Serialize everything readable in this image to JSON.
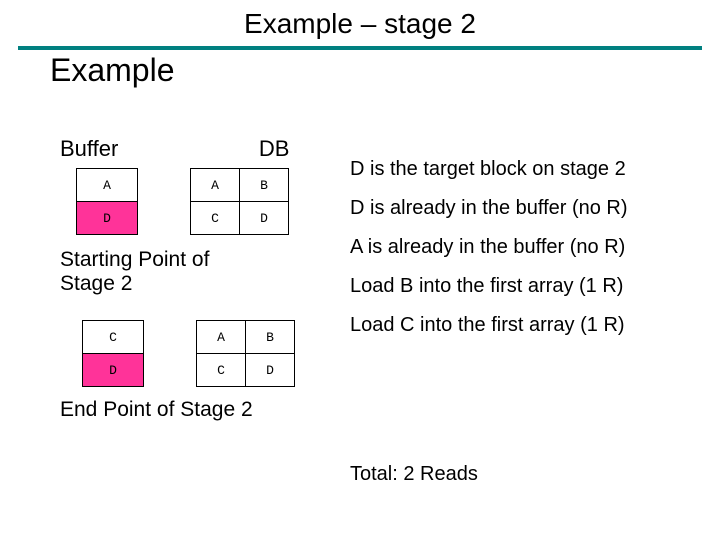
{
  "title": "Example – stage 2",
  "subheader": "Example",
  "headers": {
    "buffer": "Buffer",
    "db": "DB"
  },
  "start": {
    "buffer": {
      "r0": "A",
      "r1": "D"
    },
    "db": {
      "r0c0": "A",
      "r0c1": "B",
      "r1c0": "C",
      "r1c1": "D"
    },
    "caption_l1": "Starting Point of",
    "caption_l2": "Stage 2"
  },
  "end": {
    "buffer": {
      "r0": "C",
      "r1": "D"
    },
    "db": {
      "r0c0": "A",
      "r0c1": "B",
      "r1c0": "C",
      "r1c1": "D"
    },
    "caption": "End Point of Stage 2"
  },
  "notes": {
    "n1": "D is the target block on stage 2",
    "n2": "D is already in the buffer (no R)",
    "n3": "A is already in the buffer (no R)",
    "n4": "Load B into the first array (1 R)",
    "n5": "Load C into the first array (1 R)"
  },
  "total": "Total: 2 Reads"
}
